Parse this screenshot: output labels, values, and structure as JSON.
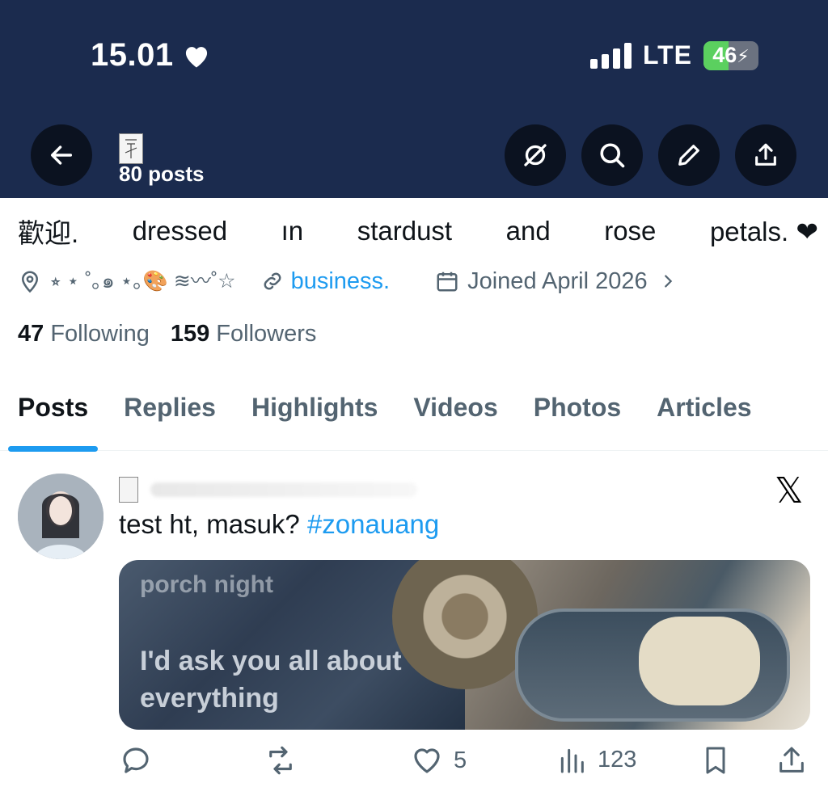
{
  "status_bar": {
    "time": "15.01",
    "network": "LTE",
    "battery": "46",
    "battery_level": 0.46
  },
  "profile_header": {
    "posts_count": "80 posts"
  },
  "bio": {
    "words": [
      "歡迎.",
      "dressed",
      "ın",
      "stardust",
      "and",
      "rose",
      "petals. ❤"
    ]
  },
  "meta": {
    "location": "⭒ ⋆ ˚｡๑ ⋆｡🎨 ≋〰˚☆",
    "link": "business.",
    "joined": "Joined April 2026"
  },
  "stats": {
    "following_count": "47",
    "following_label": "Following",
    "followers_count": "159",
    "followers_label": "Followers"
  },
  "tabs": [
    "Posts",
    "Replies",
    "Highlights",
    "Videos",
    "Photos",
    "Articles"
  ],
  "post": {
    "text": "test ht, masuk?",
    "hashtag": "#zonauang",
    "media_text_top": "porch night",
    "media_text_bottom": "I'd ask you all about everything",
    "likes": "5",
    "views": "123"
  },
  "colors": {
    "header": "#1b2b4e",
    "accent": "#1d9bf0",
    "muted": "#536471"
  }
}
